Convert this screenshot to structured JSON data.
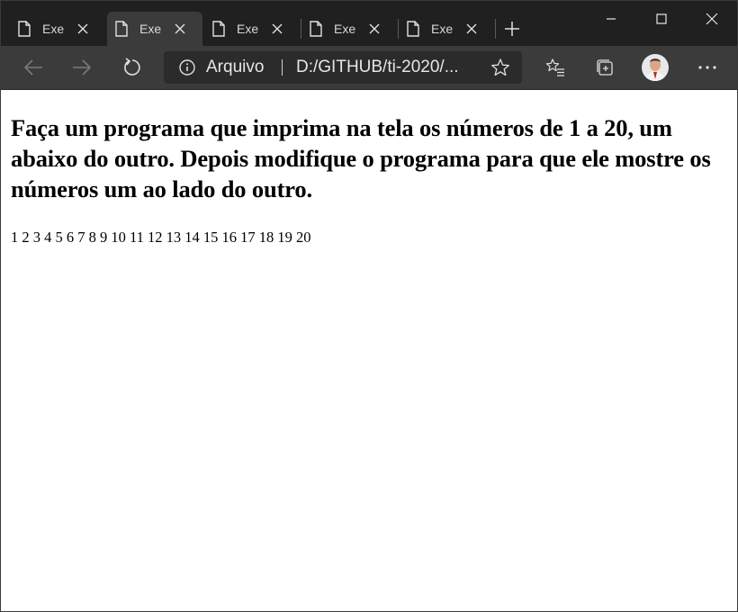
{
  "tabs": [
    {
      "label": "Exer"
    },
    {
      "label": "Exer"
    },
    {
      "label": "Exer"
    },
    {
      "label": "Exer"
    },
    {
      "label": "Exer"
    }
  ],
  "address_bar": {
    "protocol_label": "Arquivo",
    "url": "D:/GITHUB/ti-2020/..."
  },
  "toolbar_icons": [
    "back-arrow-icon",
    "forward-arrow-icon",
    "refresh-icon",
    "info-icon",
    "favorite-star-icon",
    "favorites-list-icon",
    "collections-icon",
    "profile-avatar",
    "more-icon"
  ],
  "colors": {
    "tabstrip_bg": "#202020",
    "toolbar_bg": "#3b3b3b",
    "address_bg": "#2b2b2b",
    "page_bg": "#ffffff",
    "text": "#000000"
  },
  "page": {
    "heading": "Faça um programa que imprima na tela os números de 1 a 20, um abaixo do outro. Depois modifique o programa para que ele mostre os números um ao lado do outro.",
    "numbers_line": "1 2 3 4 5 6 7 8 9 10 11 12 13 14 15 16 17 18 19 20"
  }
}
